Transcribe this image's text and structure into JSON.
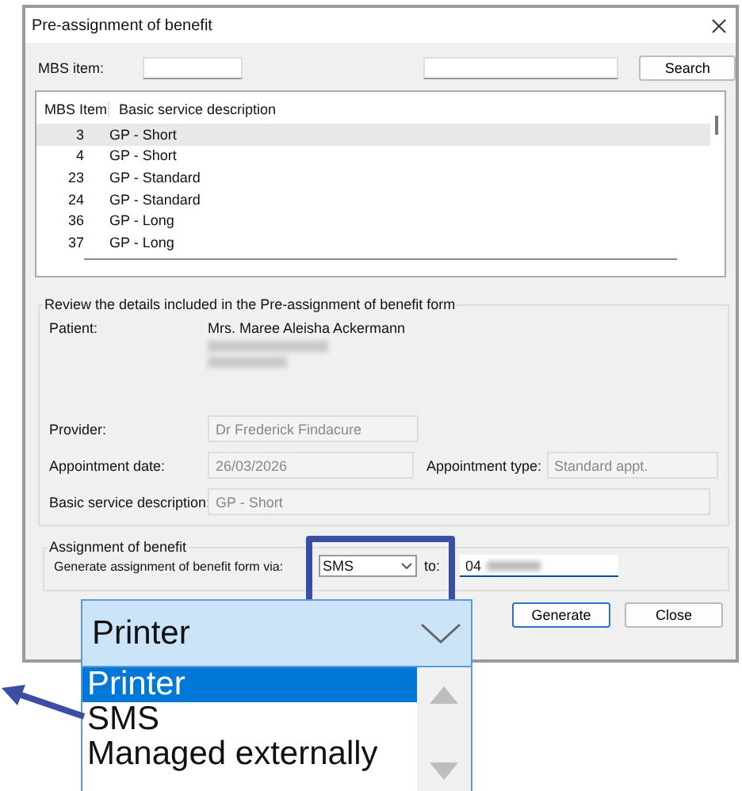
{
  "window": {
    "title": "Pre-assignment of benefit"
  },
  "search": {
    "label": "MBS item:",
    "button": "Search"
  },
  "table": {
    "columns": [
      "MBS Item",
      "Basic service description"
    ],
    "rows": [
      {
        "item": "3",
        "description": "GP - Short",
        "selected": true
      },
      {
        "item": "4",
        "description": "GP - Short",
        "selected": false
      },
      {
        "item": "23",
        "description": "GP - Standard",
        "selected": false
      },
      {
        "item": "24",
        "description": "GP - Standard",
        "selected": false
      },
      {
        "item": "36",
        "description": "GP - Long",
        "selected": false
      },
      {
        "item": "37",
        "description": "GP - Long",
        "selected": false
      }
    ]
  },
  "review": {
    "legend": "Review the details included in the Pre-assignment of benefit form",
    "patient": {
      "label": "Patient:",
      "value": "Mrs. Maree Aleisha Ackermann"
    },
    "provider": {
      "label": "Provider:",
      "value": "Dr Frederick Findacure"
    },
    "appointment_date": {
      "label": "Appointment date:",
      "value": "26/03/2026"
    },
    "appointment_type": {
      "label": "Appointment type:",
      "value": "Standard appt."
    },
    "basic_service": {
      "label": "Basic service description:",
      "value": "GP - Short"
    }
  },
  "assignment": {
    "legend": "Assignment of benefit",
    "via_label": "Generate assignment of benefit form via:",
    "method": "SMS",
    "to_label": "to:",
    "phone": "04"
  },
  "buttons": [
    "Generate",
    "Close"
  ],
  "callout": {
    "value": "Printer",
    "options": [
      {
        "label": "Printer",
        "selected": true
      },
      {
        "label": "SMS",
        "selected": false
      },
      {
        "label": "Managed externally",
        "selected": false
      }
    ]
  }
}
